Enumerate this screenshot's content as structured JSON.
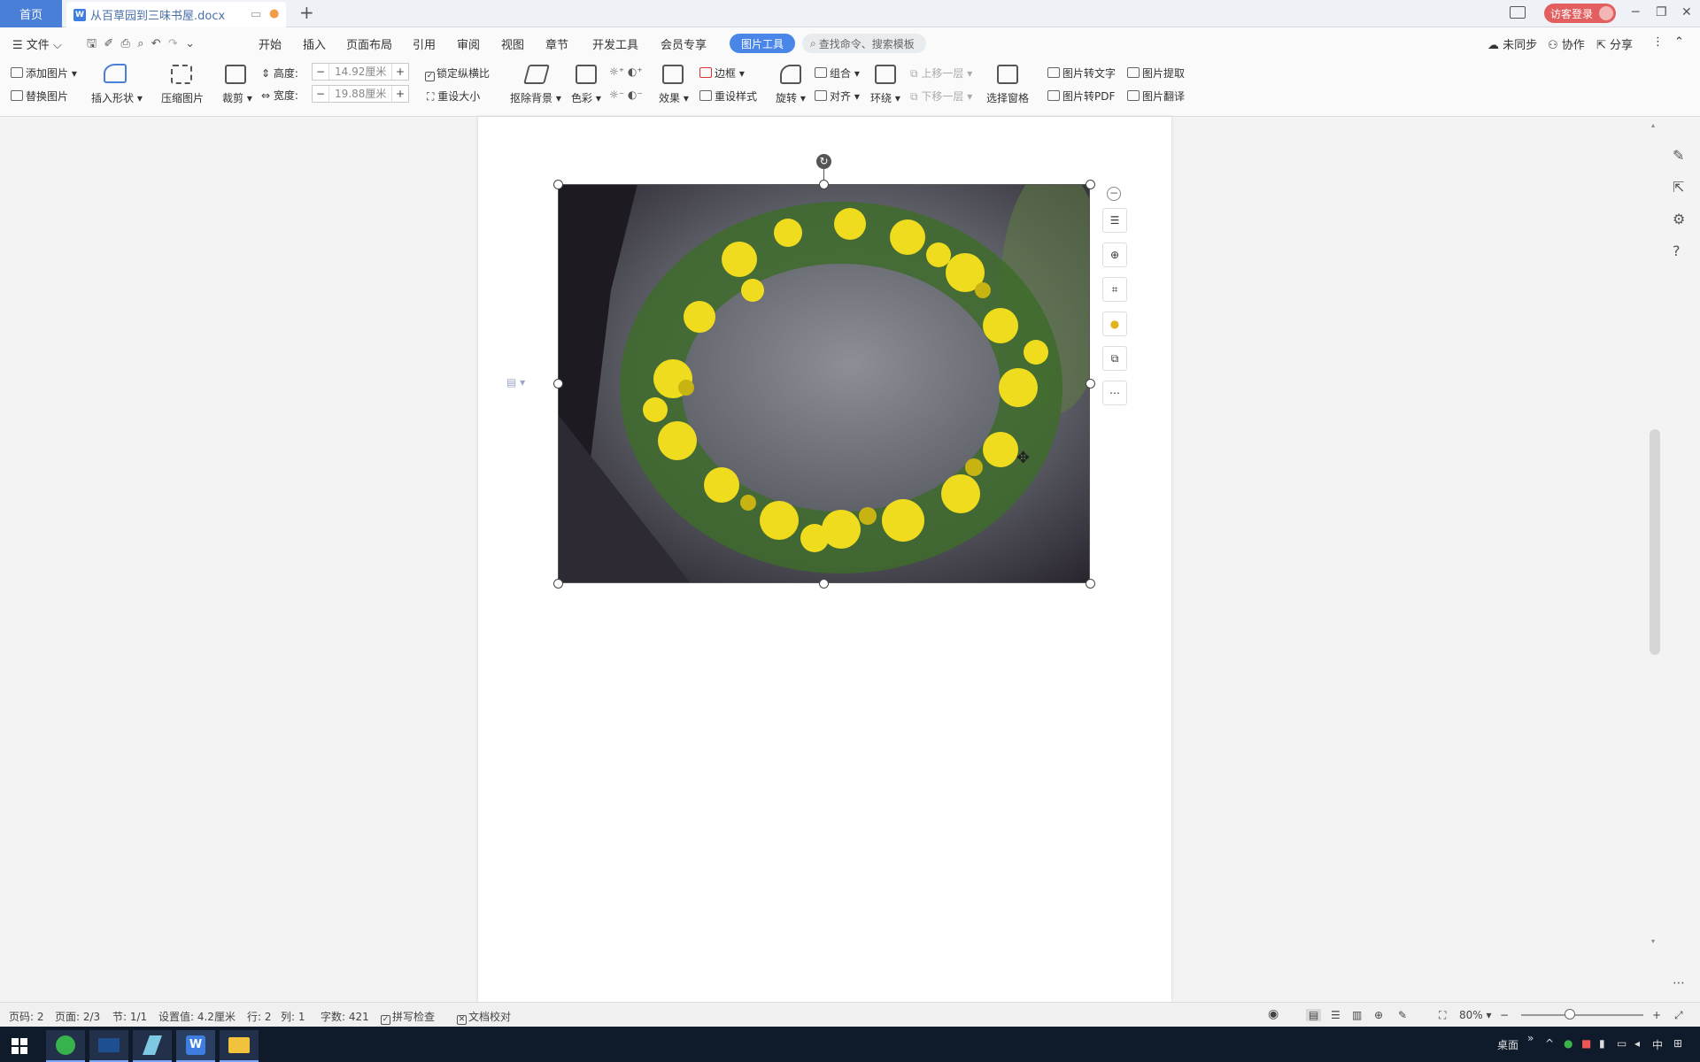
{
  "titlebar": {
    "home_tab": "首页",
    "doc_tab": "从百草园到三味书屋.docx",
    "doc_badge": "W",
    "login_button": "访客登录"
  },
  "menubar": {
    "file": "文件",
    "tabs": [
      "开始",
      "插入",
      "页面布局",
      "引用",
      "审阅",
      "视图",
      "章节",
      "开发工具",
      "会员专享"
    ],
    "active_tab": "图片工具",
    "search_placeholder": "查找命令、搜索模板",
    "right": {
      "sync": "未同步",
      "collab": "协作",
      "share": "分享"
    }
  },
  "ribbon": {
    "add_picture": "添加图片",
    "replace_picture": "替换图片",
    "insert_shape": "插入形状",
    "compress_picture": "压缩图片",
    "crop": "裁剪",
    "height_label": "高度:",
    "height_value": "14.92厘米",
    "width_label": "宽度:",
    "width_value": "19.88厘米",
    "lock_ratio": "锁定纵横比",
    "reset_size": "重设大小",
    "remove_background": "抠除背景",
    "color": "色彩",
    "effects": "效果",
    "border": "边框",
    "reset_style": "重设样式",
    "rotate": "旋转",
    "group": "组合",
    "align": "对齐",
    "wrap": "环绕",
    "bring_forward": "上移一层",
    "send_backward": "下移一层",
    "selection_pane": "选择窗格",
    "pic_to_text": "图片转文字",
    "pic_extract": "图片提取",
    "pic_to_pdf": "图片转PDF",
    "pic_translate": "图片翻译"
  },
  "statusbar": {
    "page_num": "页码: 2",
    "page_count": "页面: 2/3",
    "section": "节: 1/1",
    "setting": "设置值: 4.2厘米",
    "row": "行: 2",
    "col": "列: 1",
    "word_count": "字数: 421",
    "spell_check": "拼写检查",
    "doc_proof": "文档校对",
    "zoom": "80%",
    "zoom_level": 0.4
  },
  "taskbar": {
    "tray_desktop": "桌面",
    "tray_lang": "中"
  },
  "icons": [
    "windows-start-icon",
    "browser-icon",
    "app-icon",
    "pen-app-icon",
    "wps-icon",
    "folder-icon"
  ]
}
